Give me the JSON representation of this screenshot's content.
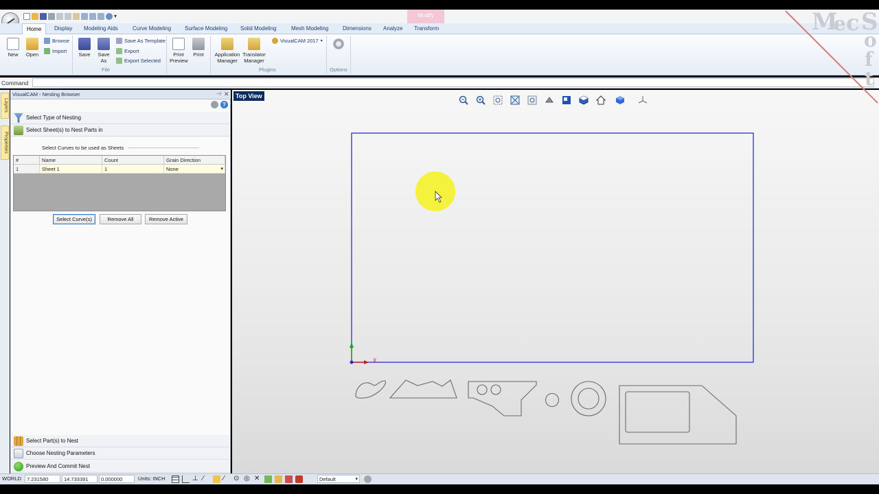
{
  "ribbon": {
    "context_tab": "Modify",
    "tabs": [
      {
        "label": "Home",
        "active": true
      },
      {
        "label": "Display"
      },
      {
        "label": "Modeling Aids"
      },
      {
        "label": "Curve Modeling"
      },
      {
        "label": "Surface Modeling"
      },
      {
        "label": "Solid Modeling"
      },
      {
        "label": "Mesh Modeling"
      },
      {
        "label": "Dimensions"
      },
      {
        "label": "Analyze"
      },
      {
        "label": "Transform"
      }
    ],
    "file": {
      "new": "New",
      "open": "Open",
      "browse": "Browse",
      "import": "Import",
      "save": "Save",
      "save_as_1": "Save",
      "save_as_2": "As",
      "save_as_template": "Save As Template",
      "export": "Export",
      "export_selected": "Export Selected",
      "print_preview_1": "Print",
      "print_preview_2": "Preview",
      "print": "Print",
      "group_label": "File"
    },
    "plugins": {
      "app_manager_1": "Application",
      "app_manager_2": "Manager",
      "translator_1": "Translator",
      "translator_2": "Manager",
      "visualcam": "VisualCAM 2017",
      "group_label": "Plugins"
    },
    "options": {
      "group_label": "Options"
    }
  },
  "command": {
    "label": "Command",
    "value": ""
  },
  "side_tabs": [
    "Layers",
    "Properties"
  ],
  "panel": {
    "title": "VisualCAM - Nesting Browser",
    "steps_top": [
      {
        "label": "Select Type of Nesting"
      },
      {
        "label": "Select Sheet(s) to Nest Parts in"
      }
    ],
    "section_label": "Select Curves to be used as Sheets",
    "grid": {
      "headers": [
        "#",
        "Name",
        "Count",
        "Grain Direction"
      ],
      "rows": [
        {
          "num": "1",
          "name": "Sheet 1",
          "count": "1",
          "grain": "None"
        }
      ]
    },
    "buttons": {
      "select_curves": "Select Curve(s)",
      "remove_all": "Remove All",
      "remove_active": "Remove Active"
    },
    "steps_bottom": [
      {
        "label": "Select Part(s) to Nest"
      },
      {
        "label": "Choose Nesting Parameters"
      },
      {
        "label": "Preview And Commit Nest"
      }
    ]
  },
  "viewport": {
    "view_label": "Top View",
    "axis_x_label": "X",
    "sheet_color": "#2b2bd6",
    "part_color": "#6a6a6a",
    "toolbar": [
      "zoom-out-icon",
      "zoom-in-icon",
      "zoom-box-icon",
      "zoom-extents-icon",
      "zoom-selected-icon",
      "pan-icon",
      "view-top-icon",
      "view-iso-icon",
      "view-home-icon",
      "shaded-display-icon",
      "xyz-axis-icon"
    ]
  },
  "status": {
    "coord_system": "WORLD",
    "x": "7.231580",
    "y": "14.733391",
    "z": "0.000000",
    "units": "Units: INCH",
    "layer": "Default"
  },
  "watermark": [
    "M",
    "e",
    "c",
    "S",
    "o",
    "f",
    "t"
  ]
}
